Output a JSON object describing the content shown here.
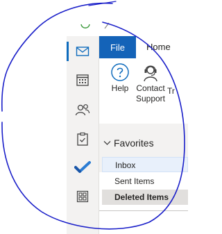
{
  "ribbon": {
    "tabs": [
      {
        "label": "File",
        "active": true
      },
      {
        "label": "Home",
        "active": false
      }
    ],
    "buttons": {
      "help": "Help",
      "contact_line1": "Contact",
      "contact_line2": "Support",
      "partial": "Tr"
    }
  },
  "nav_rail": {
    "items": [
      {
        "name": "mail",
        "icon": "mail-icon",
        "active": true
      },
      {
        "name": "calendar",
        "icon": "calendar-icon",
        "active": false
      },
      {
        "name": "people",
        "icon": "people-icon",
        "active": false
      },
      {
        "name": "tasks",
        "icon": "clipboard-check-icon",
        "active": false
      },
      {
        "name": "to-do",
        "icon": "checkmark-icon",
        "active": false
      },
      {
        "name": "apps",
        "icon": "apps-grid-icon",
        "active": false
      }
    ]
  },
  "folder_pane": {
    "section": "Favorites",
    "items": [
      {
        "label": "Inbox",
        "selected": true
      },
      {
        "label": "Sent Items",
        "selected": false
      },
      {
        "label": "Deleted Items",
        "selected": false,
        "bold": true
      }
    ]
  },
  "colors": {
    "accent": "#1463b8",
    "ink_annotation": "#1a1fc9",
    "todo_check": "#2b7cd3"
  }
}
